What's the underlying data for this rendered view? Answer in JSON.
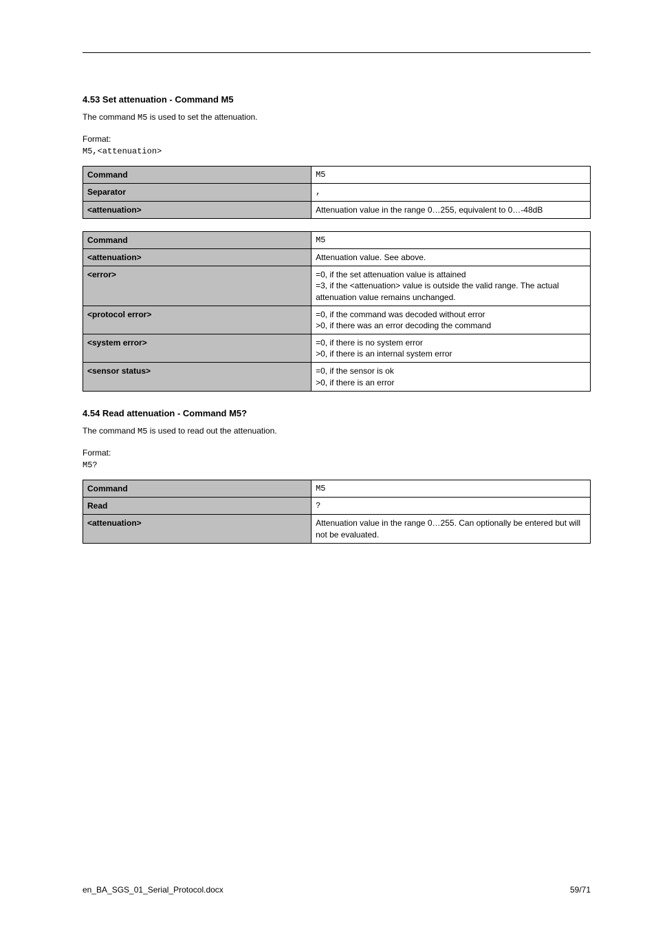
{
  "section1": {
    "title": "4.53 Set attenuation - Command M5",
    "description_pre": "The command ",
    "description_cmd": "M5",
    "description_post": " is used to set the attenuation.",
    "format_label": "Format:",
    "format_code": "M5,<attenuation>",
    "table_input": {
      "rows": [
        {
          "label": "Command",
          "value": "M5"
        },
        {
          "label": "Separator",
          "value": ","
        },
        {
          "label": "<attenuation>",
          "value": "Attenuation value in the range 0…255, equivalent to 0…-48dB"
        }
      ]
    },
    "table_output": {
      "rows": [
        {
          "label": "Command",
          "value": "M5"
        },
        {
          "label": "<attenuation>",
          "value": "Attenuation value. See above."
        },
        {
          "label": "<error>",
          "value": "=0, if the set attenuation value is attained\n=3, if the <attenuation> value is outside the valid range. The actual attenuation value remains unchanged."
        },
        {
          "label": "<protocol error>",
          "value": "=0, if the command was decoded without error\n>0, if there was an error decoding the command"
        },
        {
          "label": "<system error>",
          "value": "=0, if there is no system error\n>0, if there is an internal system error"
        },
        {
          "label": "<sensor status>",
          "value": "=0, if the sensor is ok\n>0, if there is an error"
        }
      ]
    }
  },
  "section2": {
    "title": "4.54 Read attenuation - Command M5?",
    "description_pre": "The command ",
    "description_cmd": "M5",
    "description_post": " is used to read out the attenuation.",
    "format_label": "Format:",
    "format_code": "M5?",
    "table_input": {
      "rows": [
        {
          "label": "Command",
          "value": "M5"
        },
        {
          "label": "Read",
          "value": "?"
        },
        {
          "label": "<attenuation>",
          "value": "Attenuation value in the range 0…255. Can optionally be entered but will not be evaluated."
        }
      ]
    }
  },
  "footer": {
    "left": "en_BA_SGS_01_Serial_Protocol.docx",
    "right": "59/71"
  }
}
